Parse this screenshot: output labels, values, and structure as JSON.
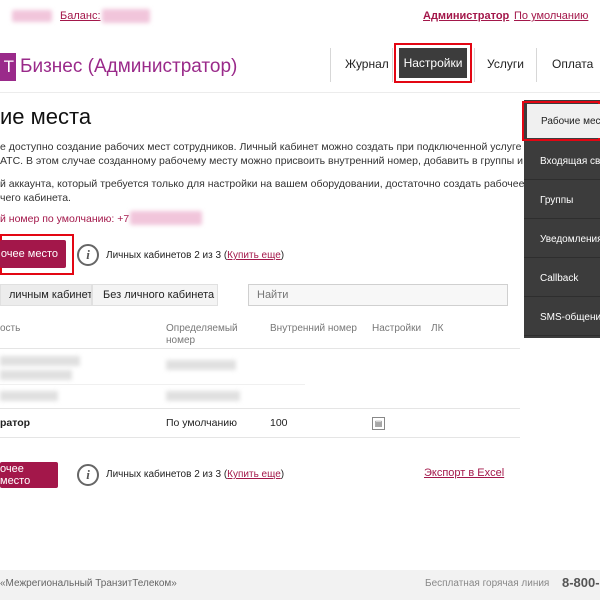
{
  "topbar": {
    "balance_label": "Баланс:",
    "admin_label": "Администратор",
    "default_label": "По умолчанию"
  },
  "logo": {
    "mark": "Т",
    "text": "Бизнес (Администратор)"
  },
  "nav": {
    "journal": "Журнал",
    "settings": "Настройки",
    "services": "Услуги",
    "payment": "Оплата"
  },
  "page": {
    "title": "ие места",
    "para1_line1": "е доступно создание рабочих мест сотрудников. Личный кабинет можно создать при подключенной услуге",
    "para1_line2": "АТС. В этом случае созданному рабочему месту можно присвоить внутренний номер, добавить в группы и",
    "para2_line1": "й аккаунта, который требуется только для настройки на вашем оборудовании, достаточно создать рабочее",
    "para2_line2": "чего кабинета.",
    "default_number": "й номер по умолчанию: +7"
  },
  "actions": {
    "add_button": "очее место",
    "cabinets_text": "Личных кабинетов 2 из 3 (",
    "buy_more": "Купить еще",
    "cabinets_close": ")",
    "info_icon": "i",
    "export": "Экспорт в Excel"
  },
  "tabs": {
    "with_cabinet": "личным кабинетом",
    "without_cabinet": "Без личного кабинета"
  },
  "search": {
    "placeholder": "Найти"
  },
  "table": {
    "headers": {
      "col1": "ость",
      "col2_line1": "Определяемый",
      "col2_line2": "номер",
      "col3": "Внутренний номер",
      "col4": "Настройки",
      "col5": "ЛК"
    },
    "admin_row": {
      "name": "ратор",
      "number": "По умолчанию",
      "internal": "100"
    }
  },
  "sidebar": {
    "items": [
      "Рабочие места",
      "Входящая связь",
      "Группы",
      "Уведомления",
      "Callback",
      "SMS-общение"
    ]
  },
  "footer": {
    "company": "«Межрегиональный ТранзитТелеком»",
    "line_label": "Бесплатная горячая линия",
    "phone": "8-800-"
  },
  "colors": {
    "accent": "#a3174a",
    "logo": "#9a2a8a",
    "nav_active": "#3c3c3c",
    "highlight": "#e30613"
  },
  "icons": {
    "info": "info-circle-icon",
    "settings": "settings-icon"
  }
}
